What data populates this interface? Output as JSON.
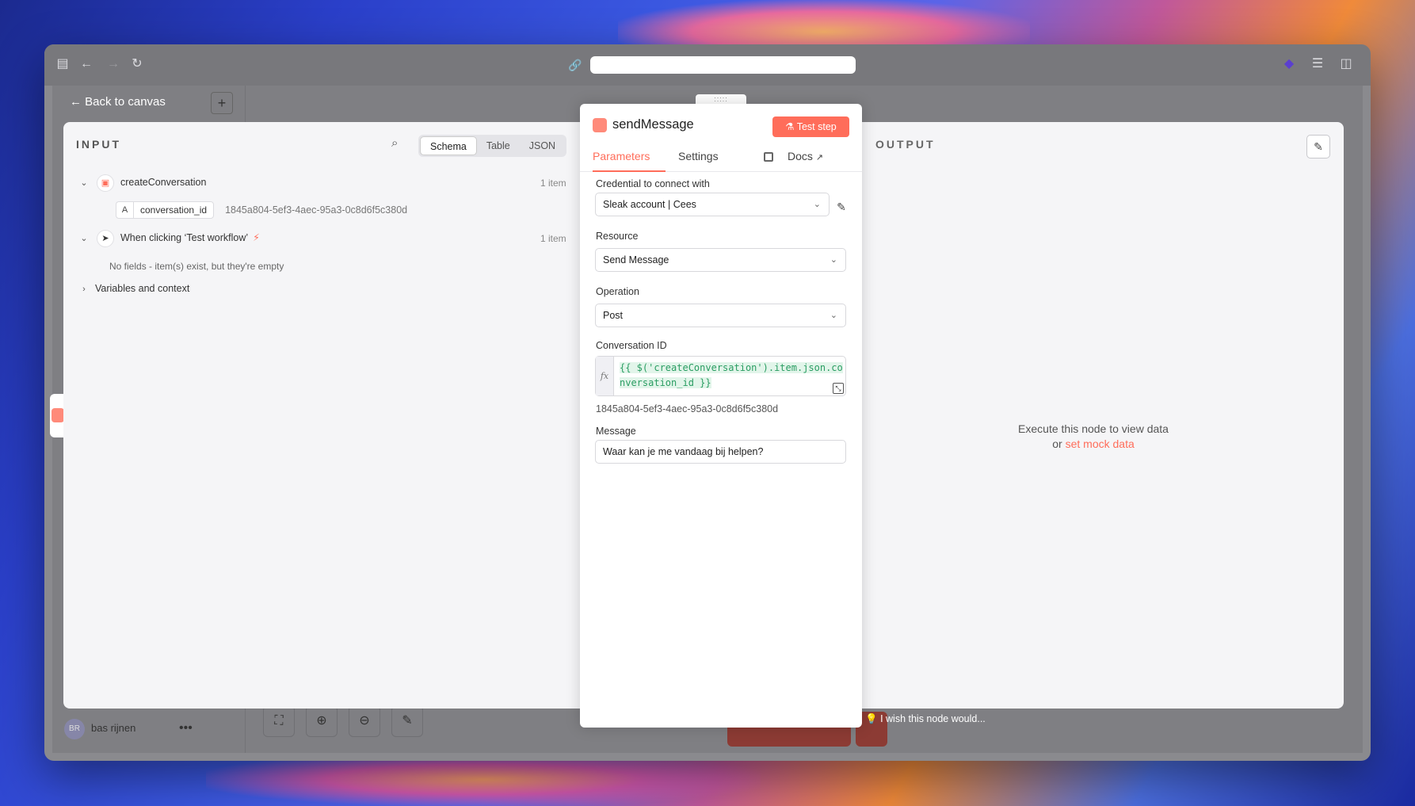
{
  "browser": {
    "sidebar_icon": "sidebar-toggle-icon",
    "back_icon": "arrow-left-icon",
    "forward_icon": "arrow-right-icon",
    "reload_icon": "reload-icon",
    "url_value": ""
  },
  "app": {
    "back_to_canvas": "Back to canvas",
    "add_button": "+",
    "user_name": "bas rijnen",
    "user_initials": "BR",
    "wish_text": "I wish this node would..."
  },
  "input": {
    "title": "INPUT",
    "views": [
      "Schema",
      "Table",
      "JSON"
    ],
    "active_view": "Schema",
    "nodes": [
      {
        "name": "createConversation",
        "count": "1 item",
        "fields": [
          {
            "type": "A",
            "name": "conversation_id",
            "value": "1845a804-5ef3-4aec-95a3-0c8d6f5c380d"
          }
        ]
      },
      {
        "name": "When clicking ‘Test workflow’",
        "count": "1 item",
        "empty_text": "No fields - item(s) exist, but they're empty"
      }
    ],
    "variables_label": "Variables and context"
  },
  "panel": {
    "node_title": "sendMessage",
    "test_button": "Test step",
    "tabs": [
      "Parameters",
      "Settings"
    ],
    "active_tab": "Parameters",
    "docs_label": "Docs",
    "credential_label": "Credential to connect with",
    "credential_value": "Sleak account | Cees",
    "resource_label": "Resource",
    "resource_value": "Send Message",
    "operation_label": "Operation",
    "operation_value": "Post",
    "conversation_label": "Conversation ID",
    "conversation_expr": "{{ $('createConversation').item.json.conversation_id }}",
    "conversation_result": "1845a804-5ef3-4aec-95a3-0c8d6f5c380d",
    "message_label": "Message",
    "message_value": "Waar kan je me vandaag bij helpen?"
  },
  "output": {
    "title": "OUTPUT",
    "empty_line1": "Execute this node to view data",
    "empty_or": "or",
    "mock_link": "set mock data"
  },
  "colors": {
    "accent": "#ff6d5a",
    "expression_green": "#2a9d62"
  }
}
